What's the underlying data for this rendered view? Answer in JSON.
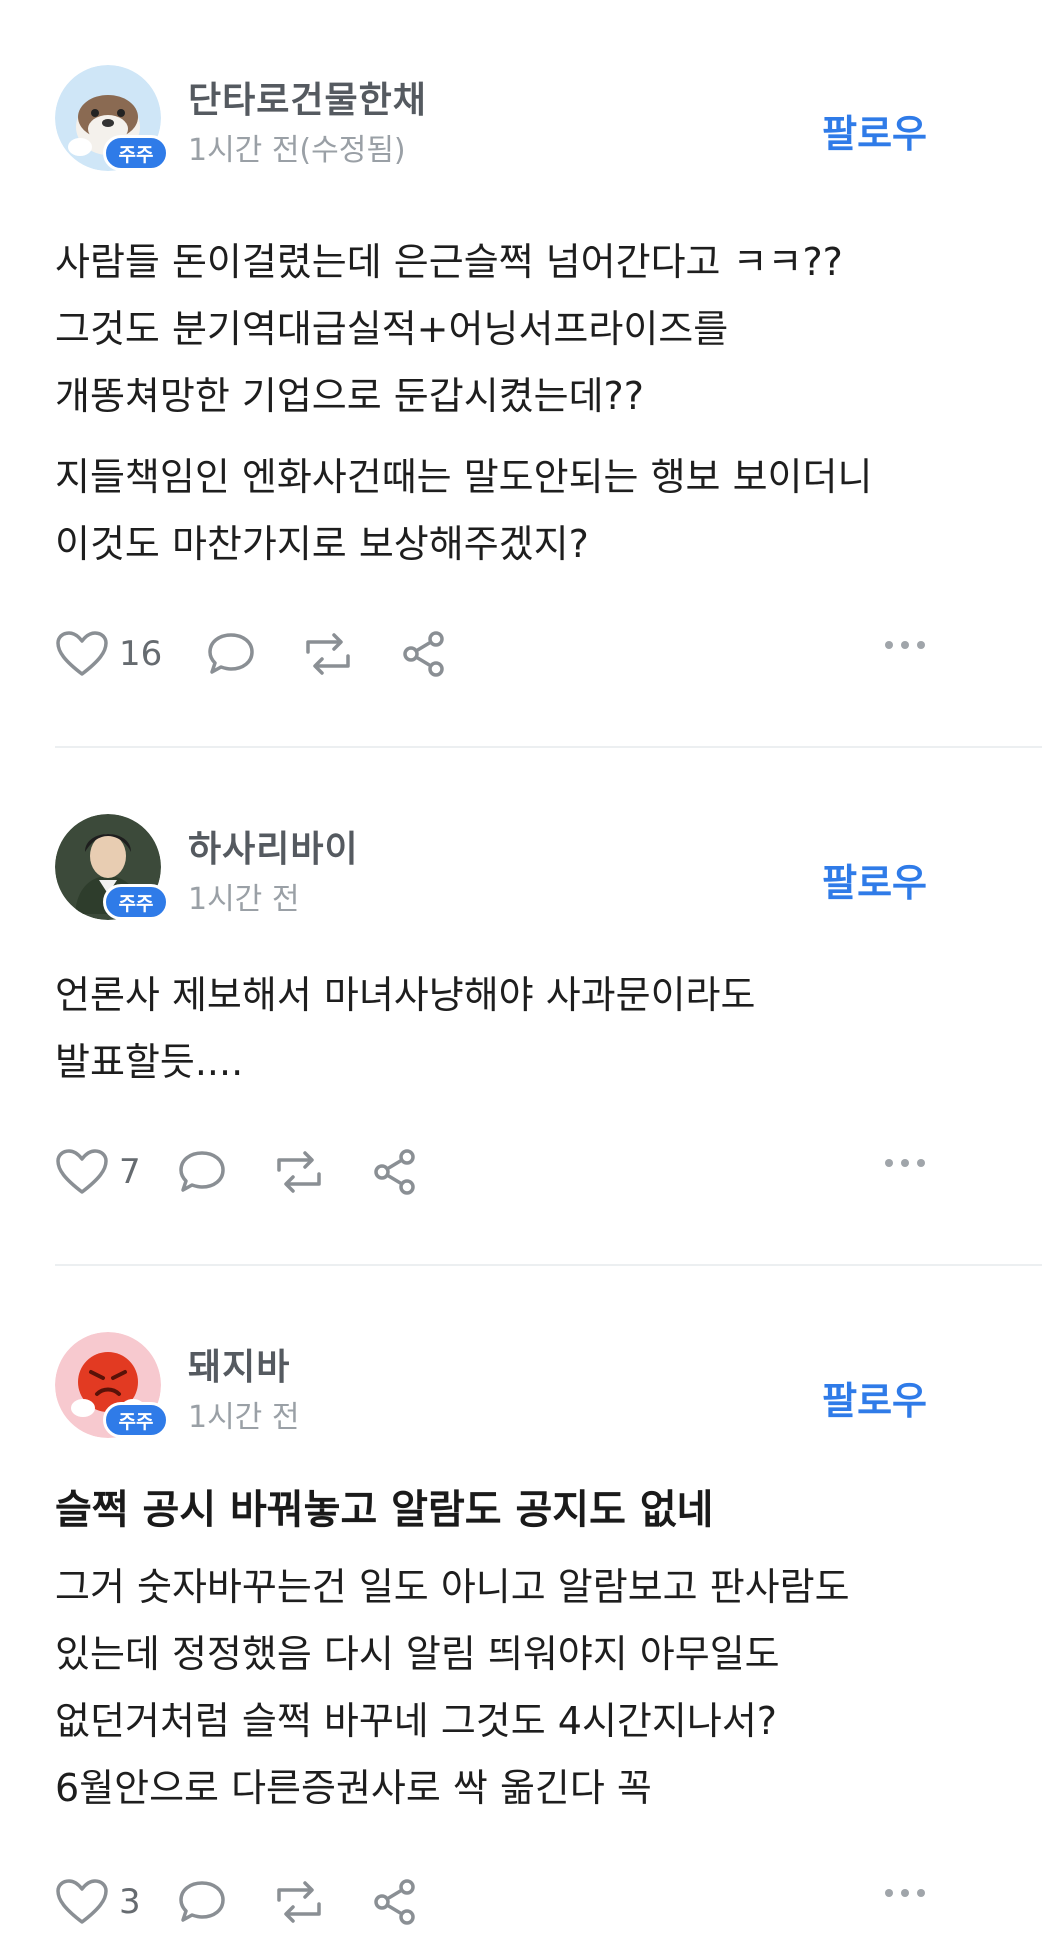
{
  "posts": [
    {
      "author": "단타로건물한채",
      "time": "1시간 전(수정됨)",
      "badge": "주주",
      "follow": "팔로우",
      "title": "",
      "paragraphs": [
        [
          "사람들 돈이걸렸는데 은근슬쩍 넘어간다고 ㅋㅋ??",
          "그것도 분기역대급실적+어닝서프라이즈를",
          "개똥쳐망한 기업으로 둔갑시켰는데??"
        ],
        [
          "지들책임인 엔화사건때는 말도안되는 행보 보이더니",
          "이것도 마찬가지로 보상해주겠지?"
        ]
      ],
      "likes": "16",
      "avatar": "otter"
    },
    {
      "author": "하사리바이",
      "time": "1시간 전",
      "badge": "주주",
      "follow": "팔로우",
      "title": "",
      "paragraphs": [
        [
          "언론사 제보해서 마녀사냥해야 사과문이라도",
          "발표할듯...."
        ]
      ],
      "likes": "7",
      "avatar": "anime"
    },
    {
      "author": "돼지바",
      "time": "1시간 전",
      "badge": "주주",
      "follow": "팔로우",
      "title": "슬쩍 공시 바꿔놓고 알람도 공지도 없네",
      "paragraphs": [
        [
          "그거 숫자바꾸는건 일도 아니고 알람보고 판사람도",
          "있는데 정정했음 다시 알림 띄워야지 아무일도",
          "없던거처럼 슬쩍 바꾸네 그것도 4시간지나서?",
          "6월안으로 다른증권사로 싹 옮긴다 꼭"
        ]
      ],
      "likes": "3",
      "avatar": "angry"
    }
  ],
  "colors": {
    "accent": "#2f7be8",
    "author": "#555a60",
    "meta": "#9aa0a6",
    "icon": "#8a8f94"
  }
}
